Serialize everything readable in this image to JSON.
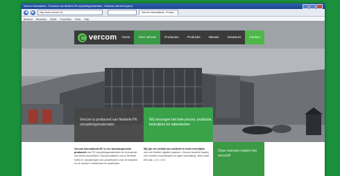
{
  "browser": {
    "title": "Vercom International - Producent van flexibele PE-verpakkingsmaterialen - Windows Internet Explorer",
    "url": "http://www.vercom.nl/",
    "tab": "Vercom International - Produc...",
    "back_glyph": "◀",
    "forward_glyph": "▶",
    "menu": [
      "Bestand",
      "Bewerken",
      "Beeld",
      "Favorieten",
      "Extra",
      "Help"
    ]
  },
  "site": {
    "logo": "vercom",
    "nav": [
      "Home",
      "Over vercom",
      "Producten",
      "Productie",
      "Nieuws",
      "Vacatures",
      "Contact"
    ],
    "hero_left": "Vercom is producent van flexibele PE verpakkingsmaterialen",
    "hero_right": "Wij verzorgen het hele proces: productie, bedrukken en nabewerken",
    "col1_bold": "Vercom International BV is een toonaangevende producent",
    "col1_rest": " van PE verpakkingsmaterialen en leverancier van breed assortiment. Wij specialiseren ons in flexibele folies en verpakkingen van polyethyleen voor de industrie en de handel in Nederland en daarbuiten.",
    "col2_bold": "Wij zijn een bedrijf van snelheid en korte levertijden",
    "col2_rest": " met een flexibel logistiek systeem. Vercom beschikt daarbij over modern machinepark en eigen bedrukking, alles onder één dak.",
    "col2_link": "Lees meer",
    "cta": "Onze mensen maken het verschil!"
  },
  "colors": {
    "brand_green": "#3a9a45",
    "frame_green": "#1a8f3c"
  }
}
